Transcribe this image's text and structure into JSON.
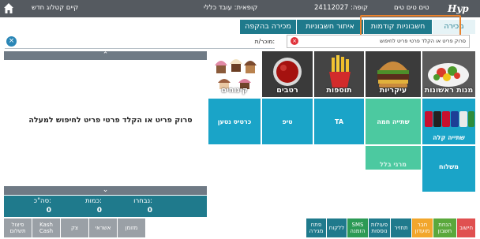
{
  "topbar": {
    "terminal_name": "טים טים טים",
    "register_label": "קופה: 24112027",
    "cashier_label": "קופאית: עובד כללי",
    "status_text": "קיים קטלוג חדש",
    "brand": "Hyp"
  },
  "tabs": [
    {
      "label": "מכירה"
    },
    {
      "label": "חשבוניות קודמות"
    },
    {
      "label": "איתור חשבוניות"
    },
    {
      "label": "מכירה בהקפה"
    }
  ],
  "search": {
    "placeholder": "סרוק פריט או הקלד פרטי פריט לחיפוש"
  },
  "customer": {
    "label": "מוכר/ת:"
  },
  "cart": {
    "empty_message": "סרוק פריט או הקלד פרטי פריט לחיפוש למעלה",
    "totals": [
      {
        "label": "סה\"כ:",
        "value": "0"
      },
      {
        "label": "כמות:",
        "value": "0"
      },
      {
        "label": "נבחרו:",
        "value": "0"
      }
    ]
  },
  "payments": [
    {
      "label": "פיצול תשלום"
    },
    {
      "label": "Kash Cash"
    },
    {
      "label": "צק"
    },
    {
      "label": "אשראי"
    },
    {
      "label": "מזומן"
    }
  ],
  "categories": [
    {
      "label": "מנות ראשונות",
      "icon": "salad-icon"
    },
    {
      "label": "עיקריות",
      "icon": "burger-icon"
    },
    {
      "label": "תוספות",
      "icon": "fries-icon"
    },
    {
      "label": "רטבים",
      "icon": "sauce-icon"
    },
    {
      "label": "קינוחים",
      "icon": "cupcakes-icon"
    }
  ],
  "items": [
    {
      "label": "שתייה קלה",
      "color": "#1aa4c8"
    },
    {
      "label": "שתייה חמה",
      "color": "#4cc9a0"
    },
    {
      "label": "TA",
      "color": "#1aa4c8"
    },
    {
      "label": "טיפ",
      "color": "#1aa4c8"
    },
    {
      "label": "כרטיס נטען",
      "color": "#1aa4c8"
    },
    {
      "label": "משלוח",
      "color": "#1aa4c8"
    },
    {
      "label": "מרגי בלל",
      "color": "#4cc9a0"
    }
  ],
  "functions": [
    {
      "label": "חישוב",
      "color": "#e05050"
    },
    {
      "label": "הנחת חשבון",
      "color": "#5aa83c"
    },
    {
      "label": "חבר מועדון",
      "color": "#f2a62c"
    },
    {
      "label": "תחזיר",
      "color": "#1f7a8c"
    },
    {
      "label": "פעולות נוספות",
      "color": "#1f7a8c"
    },
    {
      "label": "SMS הזמנה",
      "color": "#2c9a55"
    },
    {
      "label": "ללקוח",
      "color": "#1f7a8c"
    },
    {
      "label": "פתח מגירה",
      "color": "#1f7a8c"
    }
  ]
}
